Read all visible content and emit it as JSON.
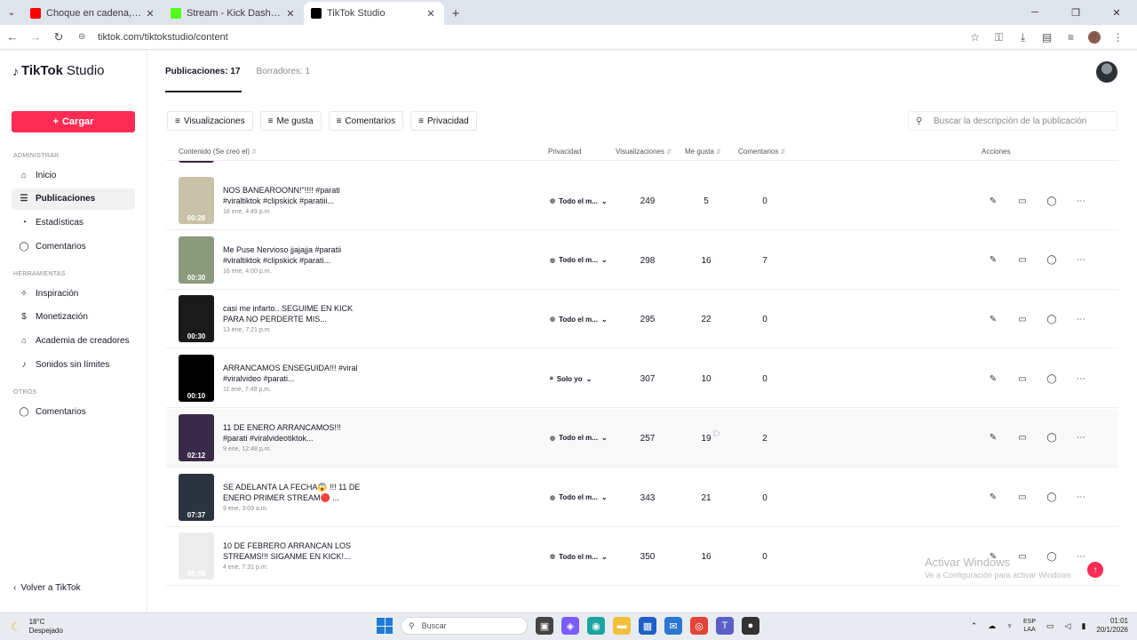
{
  "browser": {
    "tabs": [
      {
        "title": "Choque en cadena, la JEEP de E",
        "color": "#ff0000"
      },
      {
        "title": "Stream - Kick Dashboard",
        "color": "#53fc18"
      },
      {
        "title": "TikTok Studio",
        "color": "#000000"
      }
    ],
    "url": "tiktok.com/tiktokstudio/content"
  },
  "sidebar": {
    "logo": "TikTok",
    "logo_suffix": "Studio",
    "upload_label": "Cargar",
    "sections": [
      {
        "header": "ADMINISTRAR",
        "items": [
          {
            "label": "Inicio",
            "icon": "home-icon",
            "glyph": "⌂"
          },
          {
            "label": "Publicaciones",
            "icon": "posts-icon",
            "glyph": "☰"
          },
          {
            "label": "Estadísticas",
            "icon": "stats-icon",
            "glyph": "◔"
          },
          {
            "label": "Comentarios",
            "icon": "comment-icon",
            "glyph": "◯"
          }
        ]
      },
      {
        "header": "HERRAMIENTAS",
        "items": [
          {
            "label": "Inspiración",
            "icon": "bulb-icon",
            "glyph": "✧"
          },
          {
            "label": "Monetización",
            "icon": "money-icon",
            "glyph": "$"
          },
          {
            "label": "Academia de creadores",
            "icon": "academy-icon",
            "glyph": "⌂"
          },
          {
            "label": "Sonidos sin límites",
            "icon": "music-icon",
            "glyph": "♪"
          }
        ]
      },
      {
        "header": "OTROS",
        "items": [
          {
            "label": "Comentarios",
            "icon": "feedback-icon",
            "glyph": "◯"
          }
        ]
      }
    ],
    "back_label": "Volver a TikTok"
  },
  "main": {
    "tabs": [
      "Publicaciones: 17",
      "Borradores: 1"
    ],
    "filters": [
      "Visualizaciones",
      "Me gusta",
      "Comentarios",
      "Privacidad"
    ],
    "search_placeholder": "Buscar la descripción de la publicación",
    "columns": {
      "content": "Contenido (Se creó el)",
      "privacy": "Privacidad",
      "views": "Visualizaciones",
      "likes": "Me gusta",
      "comments": "Comentarios",
      "actions": "Acciones"
    },
    "rows": [
      {
        "title": "NOS BANEAROONN!\"!!!! #parati #viraltiktok #clipskick #paratiii...",
        "date": "18 ene, 4:49 p.m.",
        "duration": "00:26",
        "privacy": "Todo el m...",
        "private": false,
        "views": "249",
        "likes": "5",
        "comments": "0",
        "thumb": "#c9c2a8"
      },
      {
        "title": "Me Puse Nervioso jjajajja #paratii #viraltiktok #clipskick #parati...",
        "date": "16 ene, 4:00 p.m.",
        "duration": "00:30",
        "privacy": "Todo el m...",
        "private": false,
        "views": "298",
        "likes": "16",
        "comments": "7",
        "thumb": "#8a9a7a"
      },
      {
        "title": "casi me infarto.. SEGUIME EN KICK PARA NO PERDERTE MIS...",
        "date": "13 ene, 7:21 p.m.",
        "duration": "00:30",
        "privacy": "Todo el m...",
        "private": false,
        "views": "295",
        "likes": "22",
        "comments": "0",
        "thumb": "#1a1a1a"
      },
      {
        "title": "ARRANCAMOS ENSEGUIDA!!! #viral #viralvideo #parati...",
        "date": "11 ene, 7:49 p.m.",
        "duration": "00:10",
        "privacy": "Solo yo",
        "private": true,
        "views": "307",
        "likes": "10",
        "comments": "0",
        "thumb": "#000000"
      },
      {
        "title": "11 DE ENERO ARRANCAMOS!!! #parati #viralvideotiktok...",
        "date": "9 ene, 12:48 p.m.",
        "duration": "02:12",
        "privacy": "Todo el m...",
        "private": false,
        "views": "257",
        "likes": "19",
        "comments": "2",
        "thumb": "#3a2a4a"
      },
      {
        "title": "SE ADELANTA LA FECHA😱 !!! 11 DE ENERO PRIMER STREAM🔴 ...",
        "date": "9 ene, 3:09 a.m.",
        "duration": "07:37",
        "privacy": "Todo el m...",
        "private": false,
        "views": "343",
        "likes": "21",
        "comments": "0",
        "thumb": "#2a3440"
      },
      {
        "title": "10 DE FEBRERO ARRANCAN LOS STREAMS!!! SIGANME EN KICK!...",
        "date": "4 ene, 7:31 p.m.",
        "duration": "05:08",
        "privacy": "Todo el m...",
        "private": false,
        "views": "350",
        "likes": "16",
        "comments": "0",
        "thumb": "#ececec"
      }
    ]
  },
  "watermark": {
    "line1": "Activar Windows",
    "line2": "Ve a Configuración para activar Windows."
  },
  "taskbar": {
    "temp": "18°C",
    "weather": "Despejado",
    "search": "Buscar",
    "lang1": "ESP",
    "lang2": "LAA",
    "time": "01:01",
    "date": "20/1/2026"
  }
}
